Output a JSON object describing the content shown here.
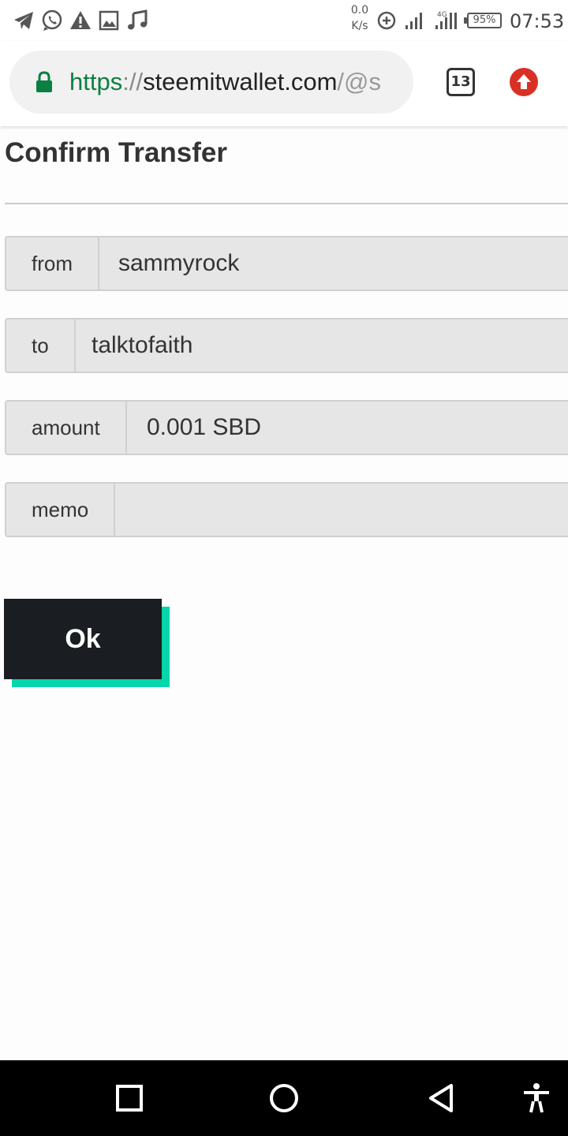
{
  "status_bar": {
    "net_speed_value": "0.0",
    "net_speed_unit": "K/s",
    "network_type": "4G",
    "battery": "95%",
    "time": "07:53",
    "notification_icons": [
      "telegram-icon",
      "whatsapp-icon",
      "warning-icon",
      "image-icon",
      "music-icon"
    ]
  },
  "browser": {
    "url_scheme": "https",
    "url_separator": "://",
    "url_host": "steemitwallet.com",
    "url_path": "/@s",
    "tab_count": "13",
    "secure_color": "#0b8043",
    "update_badge_color": "#d93025"
  },
  "page": {
    "title": "Confirm Transfer",
    "fields": [
      {
        "label": "from",
        "value": "sammyrock"
      },
      {
        "label": "to",
        "value": "talktofaith"
      },
      {
        "label": "amount",
        "value": "0.001 SBD"
      },
      {
        "label": "memo",
        "value": ""
      }
    ],
    "ok_label": "Ok",
    "ok_color": "#1a1e22",
    "accent_color": "#06d6a9"
  },
  "navbar": {
    "buttons": [
      "recents-icon",
      "home-icon",
      "back-icon",
      "accessibility-icon"
    ]
  }
}
